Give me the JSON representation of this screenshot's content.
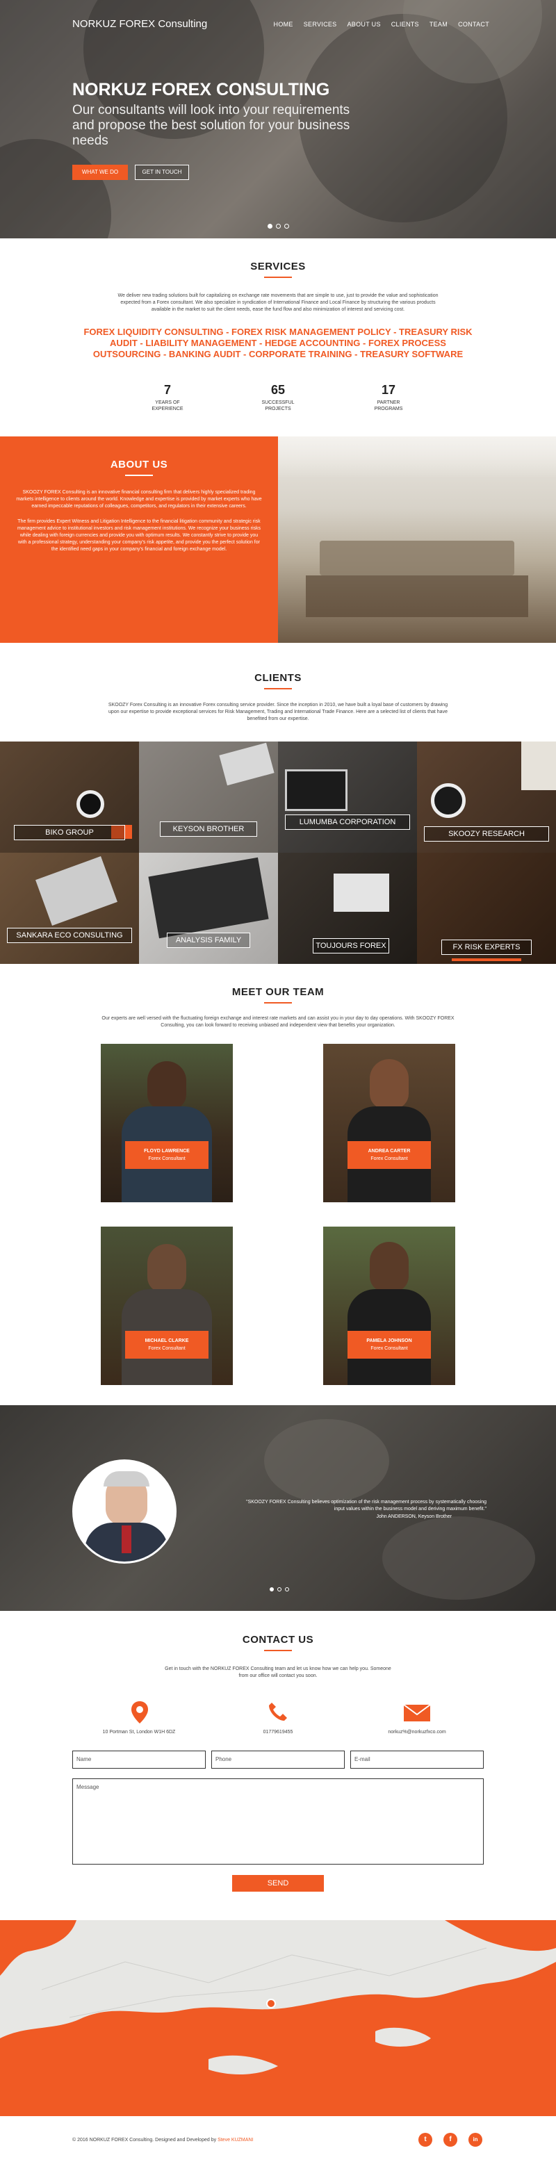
{
  "header": {
    "brand": "NORKUZ FOREX Consulting",
    "nav": [
      "HOME",
      "SERVICES",
      "ABOUT US",
      "CLIENTS",
      "TEAM",
      "CONTACT"
    ]
  },
  "hero": {
    "title": "NORKUZ FOREX CONSULTING",
    "subtitle": "Our consultants will look into your requirements and propose the best solution for your business needs",
    "btn_primary": "WHAT WE DO",
    "btn_secondary": "GET IN TOUCH",
    "slide_count": 3,
    "active_slide": 1
  },
  "services": {
    "heading": "SERVICES",
    "intro": "We deliver new trading solutions built for capitalizing on exchange rate movements that are simple to use, just to provide the value and sophistication expected from a Forex consultant. We also specialize in syndication of International Finance and Local Finance by structuring the various products available in the market to suit the client needs, ease the fund flow and also minimization of interest and servicing cost.",
    "list": "FOREX LIQUIDITY CONSULTING - FOREX RISK MANAGEMENT POLICY - TREASURY RISK AUDIT - LIABILITY MANAGEMENT - HEDGE ACCOUNTING - FOREX PROCESS OUTSOURCING - BANKING AUDIT - CORPORATE TRAINING - TREASURY SOFTWARE",
    "stats": [
      {
        "value": "7",
        "label": "YEARS OF EXPERIENCE"
      },
      {
        "value": "65",
        "label": "SUCCESSFUL PROJECTS"
      },
      {
        "value": "17",
        "label": "PARTNER PROGRAMS"
      }
    ]
  },
  "about": {
    "heading": "ABOUT US",
    "p1": "SKOOZY FOREX Consulting is an innovative financial consulting firm that delivers highly specialized trading markets intelligence to clients around the world. Knowledge and expertise is provided by market experts who have earned impeccable reputations of colleagues, competitors, and regulators in their extensive careers.",
    "p2": "The firm provides Expert Witness and Litigation Intelligence to the financial litigation community and strategic risk management advice to institutional investors and risk management institutions. We recognize your business risks while dealing with foreign currencies and provide you with optimum results. We constantly strive to provide you with a professional strategy, understanding your company's risk appetite, and provide you the perfect solution for the identified need gaps in your company's financial and foreign exchange model."
  },
  "clients": {
    "heading": "CLIENTS",
    "intro": "SKOOZY Forex Consulting is an innovative Forex consulting service provider. Since the inception in 2010, we have built a loyal base of customers by drawing upon our expertise to provide exceptional services for Risk Management, Trading and International Trade Finance. Here are a selected list of clients that have benefited from our expertise.",
    "items": [
      "BIKO GROUP",
      "KEYSON BROTHER",
      "LUMUMBA CORPORATION",
      "SKOOZY RESEARCH",
      "SANKARA ECO CONSULTING",
      "ANALYSIS FAMILY",
      "TOUJOURS FOREX",
      "FX RISK EXPERTS"
    ]
  },
  "team": {
    "heading": "MEET OUR TEAM",
    "intro": "Our experts are well versed with the fluctuating foreign exchange and interest rate markets and can assist you in your day to day operations. With SKOOZY FOREX Consulting, you can look forward to receiving unbiased and independent view that benefits your organization.",
    "members": [
      {
        "name": "FLOYD LAWRENCE",
        "role": "Forex Consultant"
      },
      {
        "name": "ANDREA CARTER",
        "role": "Forex Consultant"
      },
      {
        "name": "MICHAEL CLARKE",
        "role": "Forex Consultant"
      },
      {
        "name": "PAMELA JOHNSON",
        "role": "Forex Consultant"
      }
    ]
  },
  "testimonial": {
    "quote": "\"SKOOZY FOREX Consulting believes optimization of the risk management process by systematically choosing input values within the business model and deriving maximum benefit.\"",
    "author": "John ANDERSON, Keyson Brother"
  },
  "contact": {
    "heading": "CONTACT US",
    "intro": "Get in touch with the NORKUZ FOREX Consulting team and let us know how we can help you. Someone from our office will contact you soon.",
    "address": "10 Portman St, London W1H 6DZ",
    "phone": "01779619455",
    "email": "norkuz%@norkuzfxco.com",
    "name_placeholder": "Name",
    "phone_placeholder": "Phone",
    "email_placeholder": "E-mail",
    "message_placeholder": "Message",
    "send": "SEND"
  },
  "footer": {
    "text": "© 2016 NORKUZ FOREX Consulting. Designed and Developed by",
    "author": "Steve KUZMANI",
    "social": [
      "t",
      "f",
      "in"
    ]
  },
  "colors": {
    "accent": "#f05a24"
  }
}
